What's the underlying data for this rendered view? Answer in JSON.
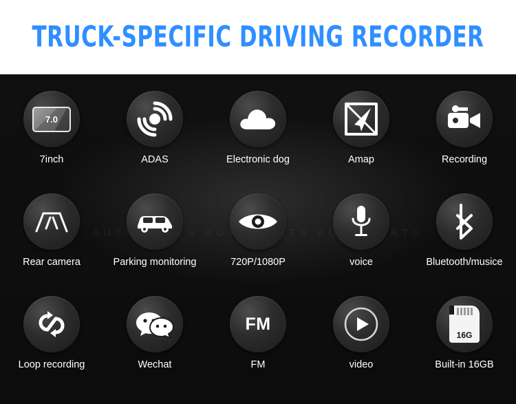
{
  "header": {
    "title": "TRUCK-SPECIFIC DRIVING RECORDER",
    "accent_color": "#2f8fff"
  },
  "panel": {
    "background_color": "#121212",
    "watermark": "AUTO PARTS    AUTO PARTS    AUTO PARTS"
  },
  "features": [
    {
      "label": "7inch",
      "icon": "screen-7-inch-icon",
      "badge": "7.0"
    },
    {
      "label": "ADAS",
      "icon": "adas-concentric-rings-icon"
    },
    {
      "label": "Electronic dog",
      "icon": "cloud-icon"
    },
    {
      "label": "Amap",
      "icon": "navigation-arrow-icon"
    },
    {
      "label": "Recording",
      "icon": "video-camera-icon"
    },
    {
      "label": "Rear camera",
      "icon": "rear-camera-lines-icon"
    },
    {
      "label": "Parking monitoring",
      "icon": "car-icon"
    },
    {
      "label": "720P/1080P",
      "icon": "eye-icon"
    },
    {
      "label": "voice",
      "icon": "microphone-icon"
    },
    {
      "label": "Bluetooth/musice",
      "icon": "bluetooth-icon"
    },
    {
      "label": "Loop recording",
      "icon": "loop-arrows-icon"
    },
    {
      "label": "Wechat",
      "icon": "wechat-bubbles-icon"
    },
    {
      "label": "FM",
      "icon": "fm-text-icon",
      "badge": "FM"
    },
    {
      "label": "video",
      "icon": "play-circle-icon"
    },
    {
      "label": "Built-in 16GB",
      "icon": "sd-card-icon",
      "badge": "16G"
    }
  ]
}
